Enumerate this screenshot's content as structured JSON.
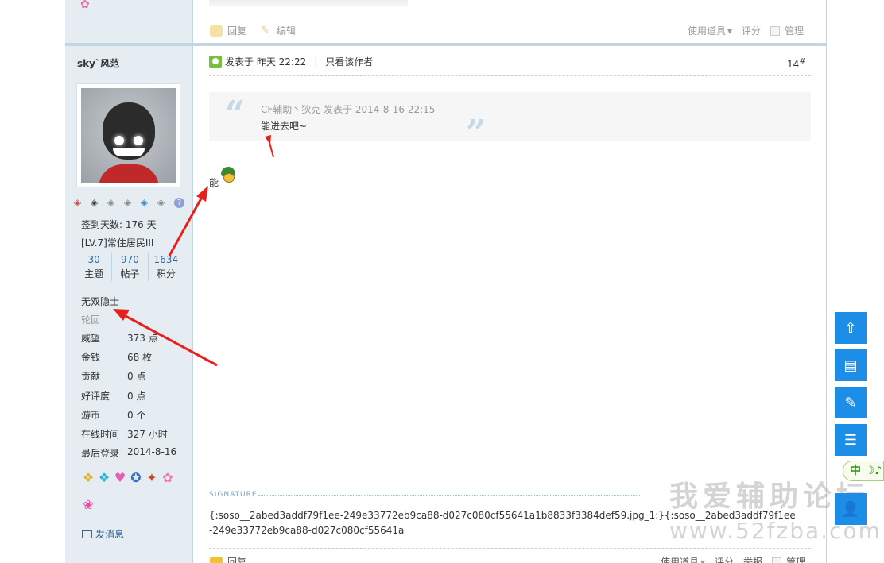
{
  "prev_post": {
    "reply": "回复",
    "edit": "编辑",
    "tools": "使用道具",
    "rate": "评分",
    "manage": "管理"
  },
  "user": {
    "name": "sky`风范",
    "checkin": "签到天数: 176 天",
    "level": "[LV.7]常住居民III",
    "stats": [
      {
        "num": "30",
        "label": "主题"
      },
      {
        "num": "970",
        "label": "帖子"
      },
      {
        "num": "1634",
        "label": "积分"
      }
    ],
    "group": "无双隐士",
    "subgroup": "轮回",
    "fields": [
      {
        "k": "威望",
        "v": "373 点"
      },
      {
        "k": "金钱",
        "v": "68 枚"
      },
      {
        "k": "贡献",
        "v": "0 点"
      },
      {
        "k": "好评度",
        "v": "0 点"
      },
      {
        "k": "游币",
        "v": "0 个"
      },
      {
        "k": "在线时间",
        "v": "327 小时"
      },
      {
        "k": "最后登录",
        "v": "2014-8-16"
      }
    ],
    "pm": "发消息"
  },
  "post": {
    "posted": "发表于 昨天 22:22",
    "author_only": "只看该作者",
    "floor": "14",
    "floor_mark": "#",
    "quote_meta": "CF辅助丶狄克 发表于 2014-8-16 22:15",
    "quote_text": "能进去吧~",
    "body": "能",
    "sig_label": "SIGNATURE",
    "sig_text": "{:soso__2abed3addf79f1ee-249e33772eb9ca88-d027c080cf55641a1b8833f3384def59.jpg_1:}{:soso__2abed3addf79f1ee-249e33772eb9ca88-d027c080cf55641a",
    "reply": "回复",
    "tools": "使用道具",
    "rate": "评分",
    "report": "举报",
    "manage": "管理"
  },
  "ime": "中",
  "watermark": {
    "cn": "我爱辅助论坛",
    "url": "www.52fzba.com"
  },
  "icons": [
    "gem-icon",
    "help-icon",
    "online-icon",
    "reply-icon",
    "edit-icon",
    "back-to-top-icon",
    "doc-icon",
    "compose-icon",
    "list-icon",
    "user-icon"
  ],
  "colors": {
    "accent": "#1d8ee8",
    "sidebar": "#e5edf2",
    "link": "#336699"
  }
}
